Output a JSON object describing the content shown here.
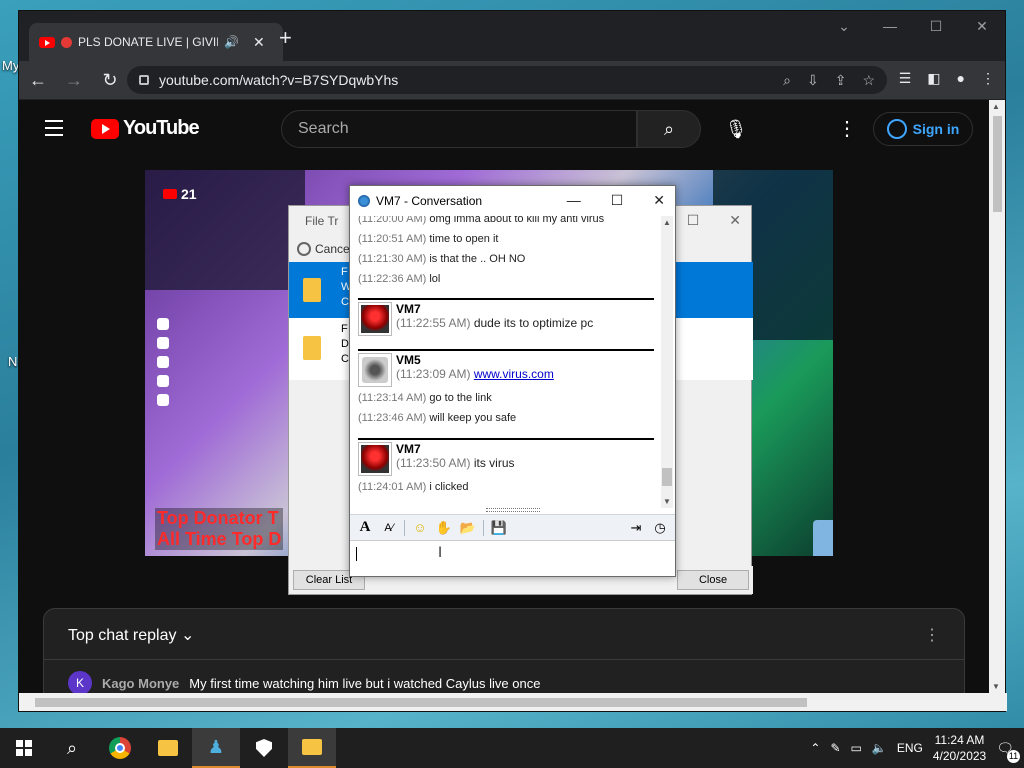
{
  "desktop": {
    "labels": [
      "My",
      "N"
    ]
  },
  "browser": {
    "tab": {
      "title": "PLS DONATE LIVE | GIVING",
      "audio_icon": "speaker-icon",
      "close": "✕"
    },
    "new_tab": "+",
    "window_controls": [
      "⌄",
      "—",
      "☐",
      "✕"
    ],
    "url": "youtube.com/watch?v=B7SYDqwbYhs"
  },
  "youtube": {
    "logo_text": "YouTube",
    "search_placeholder": "Search",
    "sign_in": "Sign in",
    "video": {
      "live_viewers": "21",
      "donor_line1": "Top Donator T",
      "donor_line2": "All Time Top D"
    },
    "chat": {
      "title": "Top chat replay",
      "message": {
        "initial": "K",
        "author": "Kago Monye",
        "text": "My first time watching him live but i watched Caylus live once"
      }
    }
  },
  "file_transfer": {
    "title": "File Tr",
    "cancel": "Cancel",
    "row1": {
      "l1": "F",
      "l2": "W",
      "l3": "C"
    },
    "row2": {
      "l1": "F",
      "l2": "D",
      "l3": "C"
    },
    "clear_list": "Clear List",
    "close": "Close"
  },
  "conversation": {
    "title": "VM7 - Conversation",
    "lines_top": [
      {
        "ts": "(11:20:00 AM)",
        "text": "omg imma about to kill my anti virus"
      },
      {
        "ts": "(11:20:51 AM)",
        "text": "time to open it"
      },
      {
        "ts": "(11:21:30 AM)",
        "text": "is that the .. OH NO"
      },
      {
        "ts": "(11:22:36 AM)",
        "text": "lol"
      }
    ],
    "block1": {
      "name": "VM7",
      "ts": "(11:22:55 AM)",
      "text": "dude its to optimize pc"
    },
    "block2": {
      "name": "VM5",
      "ts": "(11:23:09 AM)",
      "link": "www.virus.com",
      "lines": [
        {
          "ts": "(11:23:14 AM)",
          "text": "go to the link"
        },
        {
          "ts": "(11:23:46 AM)",
          "text": "will keep you safe"
        }
      ]
    },
    "block3": {
      "name": "VM7",
      "ts": "(11:23:50 AM)",
      "text": "its virus",
      "lines": [
        {
          "ts": "(11:24:01 AM)",
          "text": "i clicked"
        }
      ]
    },
    "input_value": ""
  },
  "taskbar": {
    "language": "ENG",
    "time": "11:24 AM",
    "date": "4/20/2023",
    "notifications": "11"
  }
}
